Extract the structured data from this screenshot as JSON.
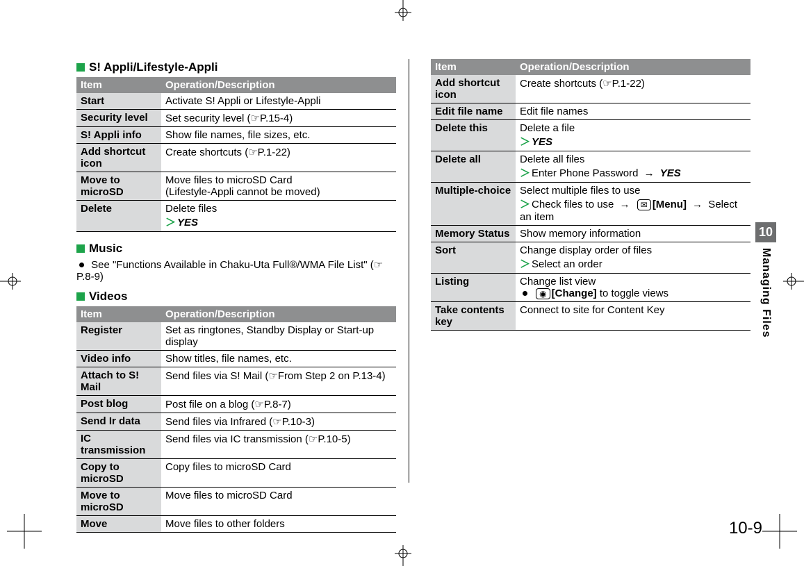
{
  "sections": {
    "appli": {
      "title": "S! Appli/Lifestyle-Appli",
      "header_item": "Item",
      "header_desc": "Operation/Description",
      "rows": [
        {
          "item": "Start",
          "desc": "Activate S! Appli or Lifestyle-Appli"
        },
        {
          "item": "Security level",
          "desc": "Set security level (☞P.15-4)"
        },
        {
          "item": "S! Appli info",
          "desc": "Show file names, file sizes, etc."
        },
        {
          "item": "Add shortcut icon",
          "desc": "Create shortcuts (☞P.1-22)"
        },
        {
          "item": "Move to microSD",
          "desc": "Move files to microSD Card\n(Lifestyle-Appli cannot be moved)"
        },
        {
          "item": "Delete",
          "desc": "Delete files",
          "action": "YES"
        }
      ]
    },
    "music": {
      "title": "Music",
      "note": "See \"Functions Available in Chaku-Uta Full®/WMA File List\" (☞P.8-9)"
    },
    "videos": {
      "title": "Videos",
      "header_item": "Item",
      "header_desc": "Operation/Description",
      "rows": [
        {
          "item": "Register",
          "desc": "Set as ringtones, Standby Display or Start-up display"
        },
        {
          "item": "Video info",
          "desc": "Show titles, file names, etc."
        },
        {
          "item": "Attach to S! Mail",
          "desc": "Send files via S! Mail (☞From Step 2 on P.13-4)"
        },
        {
          "item": "Post blog",
          "desc": "Post file on a blog (☞P.8-7)"
        },
        {
          "item": "Send Ir data",
          "desc": "Send files via Infrared (☞P.10-3)"
        },
        {
          "item": "IC transmission",
          "desc": "Send files via IC transmission (☞P.10-5)"
        },
        {
          "item": "Copy to microSD",
          "desc": "Copy files to microSD Card"
        },
        {
          "item": "Move to microSD",
          "desc": "Move files to microSD Card"
        },
        {
          "item": "Move",
          "desc": "Move files to other folders"
        }
      ]
    },
    "continued": {
      "header_item": "Item",
      "header_desc": "Operation/Description",
      "rows": [
        {
          "item": "Add shortcut icon",
          "desc": "Create shortcuts (☞P.1-22)"
        },
        {
          "item": "Edit file name",
          "desc": "Edit file names"
        },
        {
          "item": "Delete this",
          "desc": "Delete a file",
          "action": "YES"
        },
        {
          "item": "Delete all",
          "desc": "Delete all files",
          "action_pre": "Enter Phone Password",
          "action_post": "YES"
        },
        {
          "item": "Multiple-choice",
          "desc": "Select multiple files to use",
          "action_menu": "Check files to use",
          "menu_label": "[Menu]",
          "menu_tail": "Select an item"
        },
        {
          "item": "Memory Status",
          "desc": "Show memory information"
        },
        {
          "item": "Sort",
          "desc": "Change display order of files",
          "action_simple": "Select an order"
        },
        {
          "item": "Listing",
          "desc": "Change list view",
          "bullet_key": "[Change]",
          "bullet_tail": " to toggle views"
        },
        {
          "item": "Take contents key",
          "desc": "Connect to site for Content Key"
        }
      ]
    }
  },
  "side": {
    "chapter": "10",
    "label": "Managing Files"
  },
  "page_number": "10-9"
}
